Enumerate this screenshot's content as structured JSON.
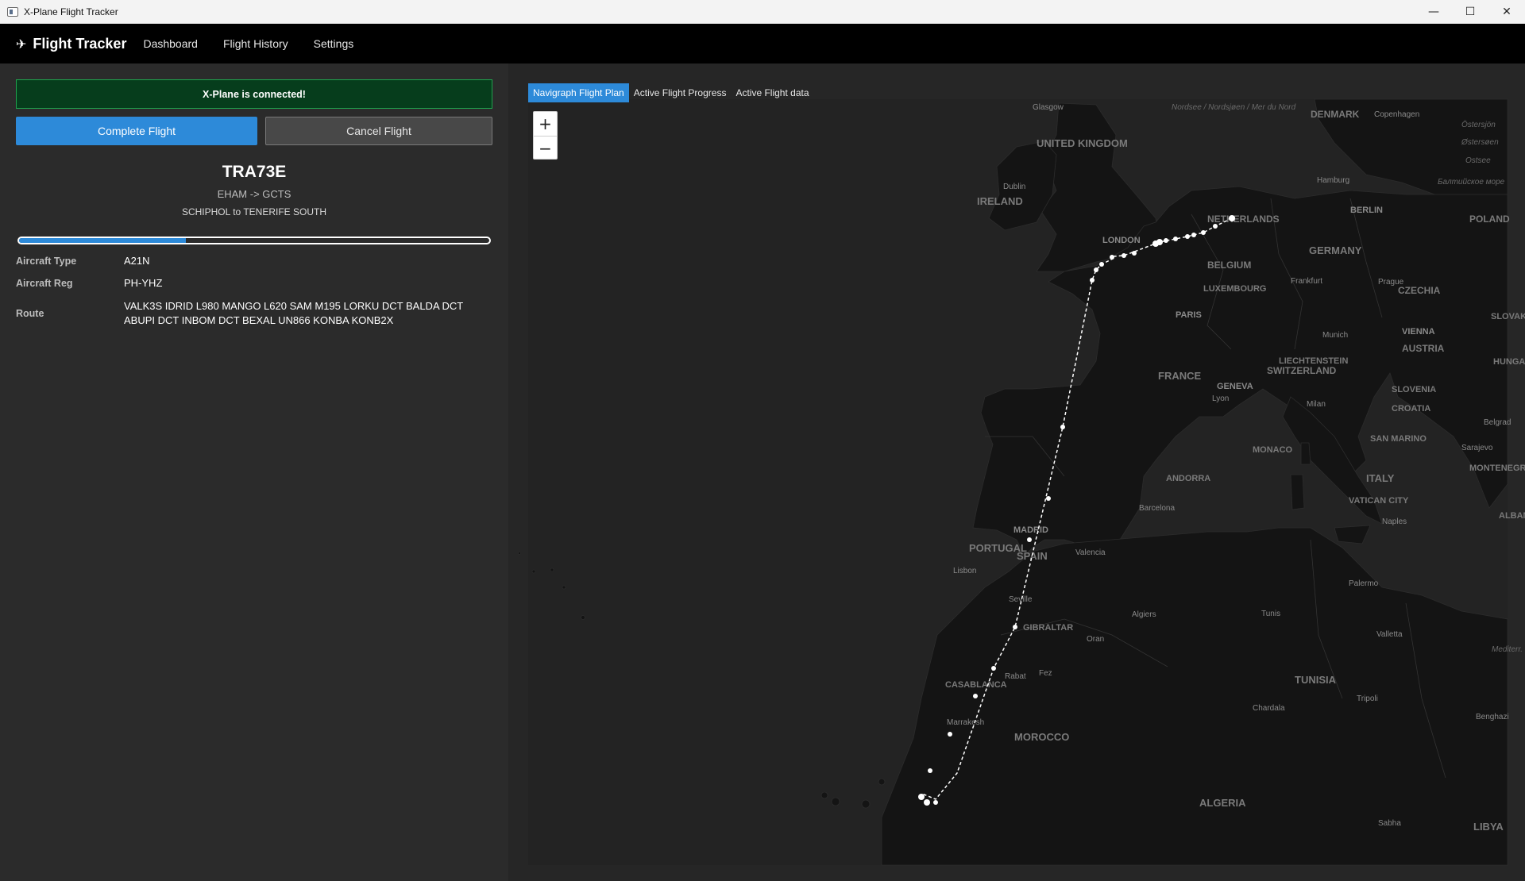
{
  "window": {
    "title": "X-Plane Flight Tracker",
    "minimize_glyph": "—",
    "maximize_glyph": "☐",
    "close_glyph": "✕"
  },
  "nav": {
    "brand": "Flight Tracker",
    "brand_icon": "✈",
    "links": [
      "Dashboard",
      "Flight History",
      "Settings"
    ]
  },
  "status": {
    "message": "X-Plane is connected!",
    "color": "#1fa34e"
  },
  "actions": {
    "complete_label": "Complete Flight",
    "cancel_label": "Cancel Flight"
  },
  "flight": {
    "callsign": "TRA73E",
    "codes": "EHAM -> GCTS",
    "names": "SCHIPHOL to TENERIFE SOUTH",
    "progress": 0.355,
    "aircraft_type_label": "Aircraft Type",
    "aircraft_type": "A21N",
    "aircraft_reg_label": "Aircraft Reg",
    "aircraft_reg": "PH-YHZ",
    "route_label": "Route",
    "route": "VALK3S IDRID L980 MANGO L620 SAM M195 LORKU DCT BALDA DCT ABUPI DCT INBOM DCT BEXAL UN866 KONBA KONB2X"
  },
  "tabs": [
    {
      "label": "Navigraph Flight Plan",
      "active": true
    },
    {
      "label": "Active Flight Progress",
      "active": false
    },
    {
      "label": "Active Flight data",
      "active": false
    }
  ],
  "zoom": {
    "in_label": "+",
    "out_label": "−"
  },
  "map_labels": {
    "glasgow": "Glasgow",
    "uk": "UNITED KINGDOM",
    "nordsee": "Nordsee / Nordsjøen / Mer du Nord",
    "denmark": "DENMARK",
    "copenhagen": "Copenhagen",
    "ostersjon": "Östersjön",
    "ostersoen": "Østersøen",
    "ostsee": "Ostsee",
    "baltic": "Балтийское море",
    "hamburg": "Hamburg",
    "dublin": "Dublin",
    "ireland": "IRELAND",
    "netherlands": "NETHERLANDS",
    "berlin": "BERLIN",
    "poland": "POLAND",
    "london": "LONDON",
    "germany": "GERMANY",
    "belgium": "BELGIUM",
    "luxembourg": "LUXEMBOURG",
    "frankfurt": "Frankfurt",
    "prague": "Prague",
    "czechia": "CZECHIA",
    "slovakia": "SLOVAKIA",
    "paris": "PARIS",
    "munich": "Munich",
    "vienna": "VIENNA",
    "austria": "AUSTRIA",
    "liechtenstein": "LIECHTENSTEIN",
    "switzerland": "SWITZERLAND",
    "hungary": "HUNGARY",
    "france": "FRANCE",
    "geneva": "GENEVA",
    "slovenia": "SLOVENIA",
    "lyon": "Lyon",
    "milan": "Milan",
    "croatia": "CROATIA",
    "belgrade": "Belgrad",
    "sarajevo": "Sarajevo",
    "monaco": "MONACO",
    "san_marino": "SAN MARINO",
    "montenegro": "MONTENEGRO",
    "andorra": "ANDORRA",
    "italy": "ITALY",
    "vatican": "VATICAN CITY",
    "barcelona": "Barcelona",
    "albania": "ALBANIA",
    "madrid": "MADRID",
    "portugal": "PORTUGAL",
    "spain": "SPAIN",
    "valencia": "Valencia",
    "naples": "Naples",
    "lisbon": "Lisbon",
    "seville": "Seville",
    "palermo": "Palermo",
    "gibraltar": "GIBRALTAR",
    "algiers": "Algiers",
    "tunis": "Tunis",
    "oran": "Oran",
    "valletta": "Valletta",
    "med_sea": "Mediterr. S.",
    "rabat": "Rabat",
    "fez": "Fez",
    "casablanca": "CASABLANCA",
    "tunisia": "TUNISIA",
    "tripoli": "Tripoli",
    "chardala": "Chardala",
    "benghazi": "Benghazi",
    "marrakesh": "Marrakesh",
    "morocco": "MOROCCO",
    "algeria": "ALGERIA",
    "sabha": "Sabha",
    "libya": "LIBYA"
  },
  "route_color": "#ffffff"
}
